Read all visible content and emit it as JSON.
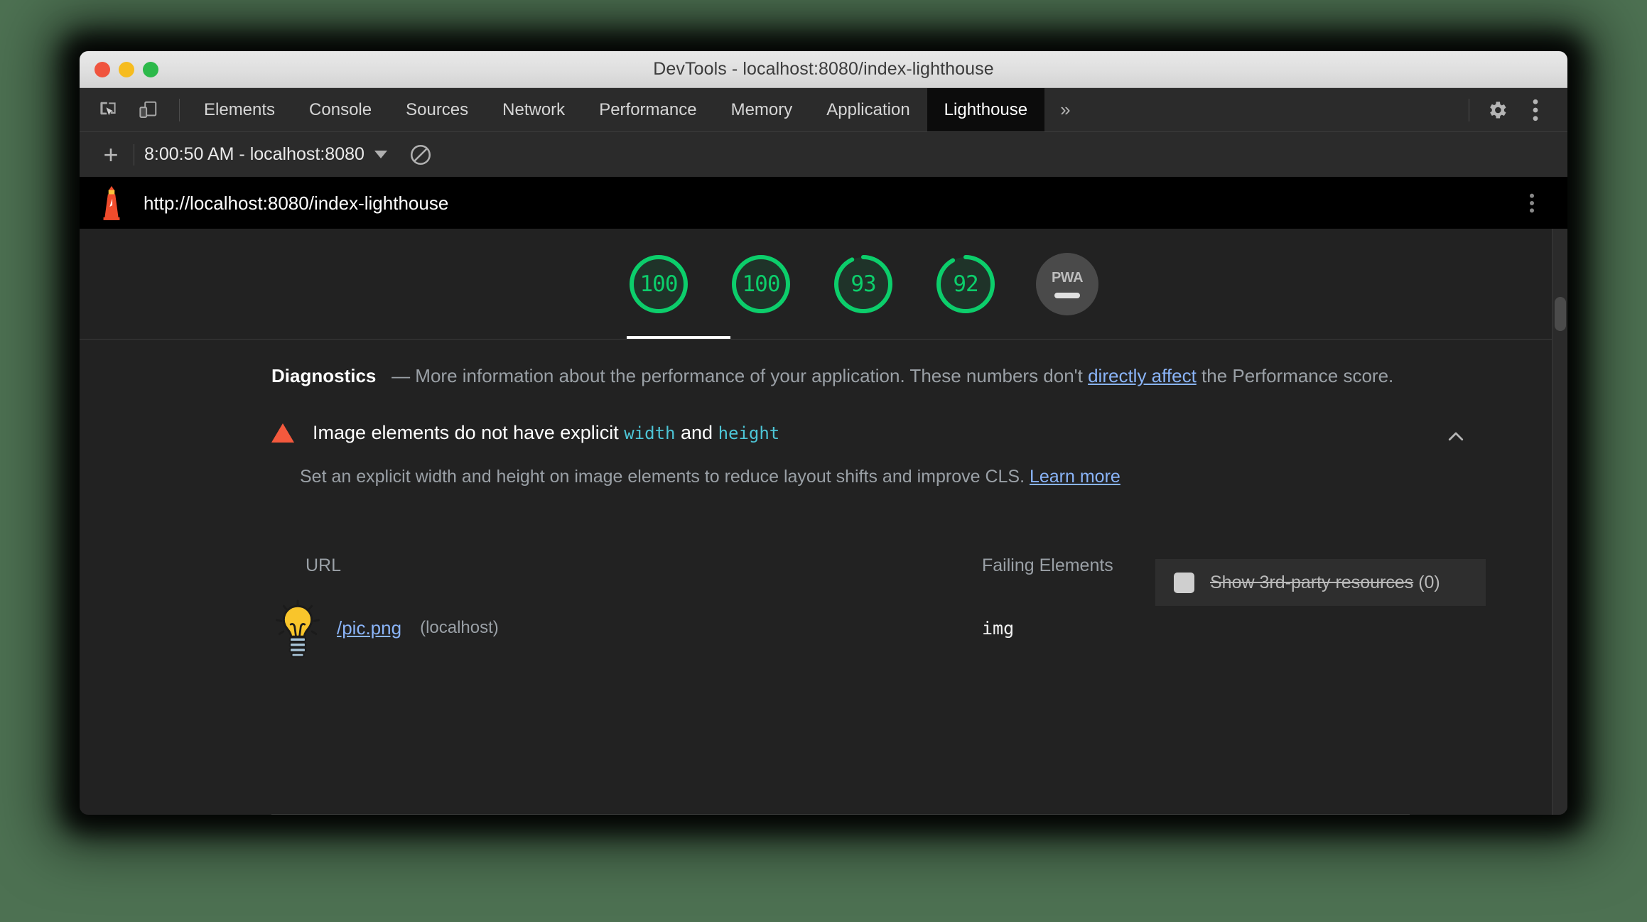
{
  "window": {
    "title": "DevTools - localhost:8080/index-lighthouse",
    "traffic_lights": [
      "close",
      "minimize",
      "maximize"
    ]
  },
  "tabstrip": {
    "icons": [
      "inspect-element-icon",
      "device-toolbar-icon"
    ],
    "tabs": [
      {
        "label": "Elements",
        "active": false
      },
      {
        "label": "Console",
        "active": false
      },
      {
        "label": "Sources",
        "active": false
      },
      {
        "label": "Network",
        "active": false
      },
      {
        "label": "Performance",
        "active": false
      },
      {
        "label": "Memory",
        "active": false
      },
      {
        "label": "Application",
        "active": false
      },
      {
        "label": "Lighthouse",
        "active": true
      }
    ],
    "more_tabs_label": "»",
    "right_icons": [
      "settings-gear-icon",
      "more-options-kebab-icon"
    ]
  },
  "lighthouse_toolbar": {
    "new_report_label": "+",
    "run_selector_value": "8:00:50 AM - localhost:8080",
    "clear_icon": "clear-all-icon"
  },
  "report": {
    "logo": "lighthouse-logo-icon",
    "url": "http://localhost:8080/index-lighthouse",
    "menu_icon": "report-menu-kebab-icon",
    "scores": [
      {
        "value": "100",
        "color": "#0cce6b",
        "percent": 100
      },
      {
        "value": "100",
        "color": "#0cce6b",
        "percent": 100
      },
      {
        "value": "93",
        "color": "#0cce6b",
        "percent": 93
      },
      {
        "value": "92",
        "color": "#0cce6b",
        "percent": 92
      }
    ],
    "pwa": {
      "label": "PWA",
      "state": "dash"
    },
    "diagnostics": {
      "title": "Diagnostics",
      "dash": "—",
      "text_before_link": "More information about the performance of your application. These numbers don't ",
      "link_text": "directly affect",
      "text_after_link": " the Performance score."
    },
    "audit": {
      "severity_icon": "warning-triangle-icon",
      "title_part1": "Image elements do not have explicit ",
      "title_code1": "width",
      "title_part2": " and ",
      "title_code2": "height",
      "collapse_icon": "chevron-up-icon",
      "description_text": "Set an explicit width and height on image elements to reduce layout shifts and improve CLS. ",
      "description_link": "Learn more",
      "third_party_toggle": {
        "checkbox_state": "unchecked",
        "label_struck": "Show 3rd-party resources",
        "count": "(0)"
      },
      "table": {
        "columns": [
          "URL",
          "Failing Elements"
        ],
        "rows": [
          {
            "thumbnail": "lightbulb-thumbnail-image",
            "url": "/pic.png",
            "host": "(localhost)",
            "failing_element": "img"
          }
        ]
      }
    }
  },
  "colors": {
    "backdrop": "#4d7152",
    "score_green": "#0cce6b",
    "link_blue": "#8ab4f8",
    "code_cyan": "#4dc5d6",
    "warning_orange": "#f4593d",
    "panel_bg": "#222222"
  }
}
